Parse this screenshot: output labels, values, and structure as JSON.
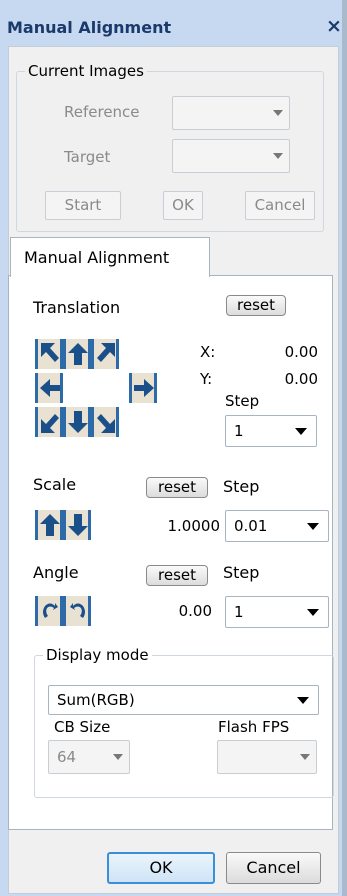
{
  "window": {
    "title": "Manual Alignment",
    "close": "×"
  },
  "current_images": {
    "legend": "Current Images",
    "reference_label": "Reference",
    "target_label": "Target",
    "start_label": "Start",
    "ok_label": "OK",
    "cancel_label": "Cancel"
  },
  "tab": {
    "label": "Manual Alignment"
  },
  "translation": {
    "label": "Translation",
    "reset_label": "reset",
    "x_label": "X:",
    "x_value": "0.00",
    "y_label": "Y:",
    "y_value": "0.00",
    "step_label": "Step",
    "step_value": "1"
  },
  "scale": {
    "label": "Scale",
    "reset_label": "reset",
    "step_label": "Step",
    "value": "1.0000",
    "step_value": "0.01"
  },
  "angle": {
    "label": "Angle",
    "reset_label": "reset",
    "step_label": "Step",
    "value": "0.00",
    "step_value": "1"
  },
  "display_mode": {
    "legend": "Display mode",
    "mode_value": "Sum(RGB)",
    "cb_size_label": "CB Size",
    "cb_size_value": "64",
    "flash_fps_label": "Flash FPS",
    "flash_fps_value": ""
  },
  "footer": {
    "ok_label": "OK",
    "cancel_label": "Cancel"
  },
  "colors": {
    "accent": "#2c6aa8",
    "title": "#1b3a6b",
    "button_face": "#e9e2d2"
  }
}
